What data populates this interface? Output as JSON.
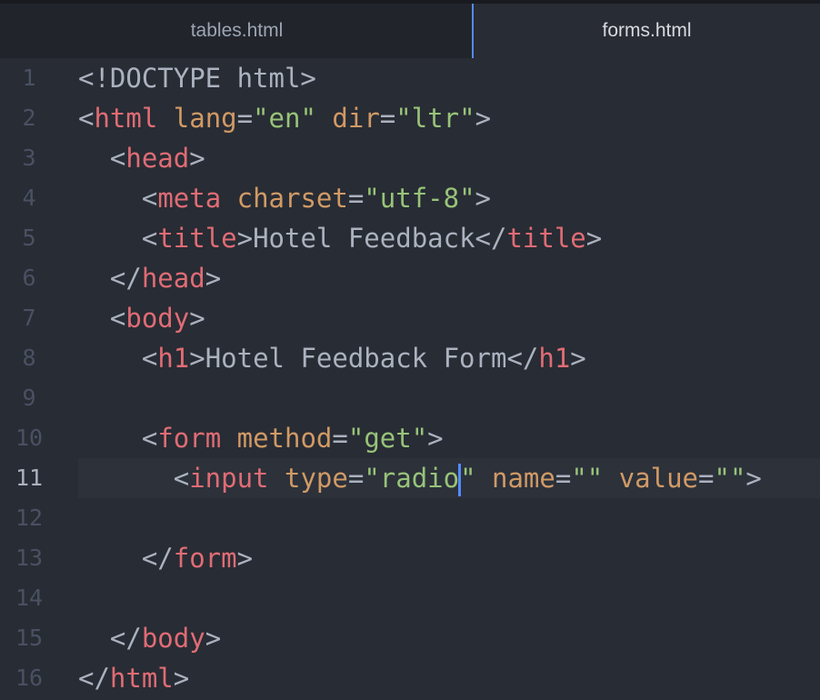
{
  "tabs": [
    {
      "label": "tables.html",
      "active": false
    },
    {
      "label": "forms.html",
      "active": true
    }
  ],
  "theme": {
    "background": "#282c34",
    "tab_bar": "#21252b",
    "tag_color": "#e06c75",
    "attr_color": "#d19a66",
    "string_color": "#98c379",
    "text_color": "#abb2bf",
    "cursor_color": "#528bff"
  },
  "editor": {
    "current_line": 11,
    "lines": [
      {
        "n": "1",
        "tokens": [
          {
            "t": "punc",
            "v": "<!DOCTYPE html>"
          }
        ]
      },
      {
        "n": "2",
        "tokens": [
          {
            "t": "punc",
            "v": "<"
          },
          {
            "t": "tag",
            "v": "html"
          },
          {
            "t": "punc",
            "v": " "
          },
          {
            "t": "attr",
            "v": "lang"
          },
          {
            "t": "punc",
            "v": "="
          },
          {
            "t": "str",
            "v": "\"en\""
          },
          {
            "t": "punc",
            "v": " "
          },
          {
            "t": "attr",
            "v": "dir"
          },
          {
            "t": "punc",
            "v": "="
          },
          {
            "t": "str",
            "v": "\"ltr\""
          },
          {
            "t": "punc",
            "v": ">"
          }
        ]
      },
      {
        "n": "3",
        "tokens": [
          {
            "t": "punc",
            "v": "  <"
          },
          {
            "t": "tag",
            "v": "head"
          },
          {
            "t": "punc",
            "v": ">"
          }
        ]
      },
      {
        "n": "4",
        "tokens": [
          {
            "t": "punc",
            "v": "    <"
          },
          {
            "t": "tag",
            "v": "meta"
          },
          {
            "t": "punc",
            "v": " "
          },
          {
            "t": "attr",
            "v": "charset"
          },
          {
            "t": "punc",
            "v": "="
          },
          {
            "t": "str",
            "v": "\"utf-8\""
          },
          {
            "t": "punc",
            "v": ">"
          }
        ]
      },
      {
        "n": "5",
        "tokens": [
          {
            "t": "punc",
            "v": "    <"
          },
          {
            "t": "tag",
            "v": "title"
          },
          {
            "t": "punc",
            "v": ">"
          },
          {
            "t": "text",
            "v": "Hotel Feedback"
          },
          {
            "t": "punc",
            "v": "</"
          },
          {
            "t": "tag",
            "v": "title"
          },
          {
            "t": "punc",
            "v": ">"
          }
        ]
      },
      {
        "n": "6",
        "tokens": [
          {
            "t": "punc",
            "v": "  </"
          },
          {
            "t": "tag",
            "v": "head"
          },
          {
            "t": "punc",
            "v": ">"
          }
        ]
      },
      {
        "n": "7",
        "tokens": [
          {
            "t": "punc",
            "v": "  <"
          },
          {
            "t": "tag",
            "v": "body"
          },
          {
            "t": "punc",
            "v": ">"
          }
        ]
      },
      {
        "n": "8",
        "tokens": [
          {
            "t": "punc",
            "v": "    <"
          },
          {
            "t": "tag",
            "v": "h1"
          },
          {
            "t": "punc",
            "v": ">"
          },
          {
            "t": "text",
            "v": "Hotel Feedback Form"
          },
          {
            "t": "punc",
            "v": "</"
          },
          {
            "t": "tag",
            "v": "h1"
          },
          {
            "t": "punc",
            "v": ">"
          }
        ]
      },
      {
        "n": "9",
        "tokens": []
      },
      {
        "n": "10",
        "tokens": [
          {
            "t": "punc",
            "v": "    <"
          },
          {
            "t": "tag",
            "v": "form"
          },
          {
            "t": "punc",
            "v": " "
          },
          {
            "t": "attr",
            "v": "method"
          },
          {
            "t": "punc",
            "v": "="
          },
          {
            "t": "str",
            "v": "\"get\""
          },
          {
            "t": "punc",
            "v": ">"
          }
        ]
      },
      {
        "n": "11",
        "tokens": [
          {
            "t": "punc",
            "v": "      <"
          },
          {
            "t": "tag",
            "v": "input"
          },
          {
            "t": "punc",
            "v": " "
          },
          {
            "t": "attr",
            "v": "type"
          },
          {
            "t": "punc",
            "v": "="
          },
          {
            "t": "str",
            "v": "\"radio"
          },
          {
            "t": "cursor",
            "v": ""
          },
          {
            "t": "str",
            "v": "\""
          },
          {
            "t": "punc",
            "v": " "
          },
          {
            "t": "attr",
            "v": "name"
          },
          {
            "t": "punc",
            "v": "="
          },
          {
            "t": "str",
            "v": "\"\""
          },
          {
            "t": "punc",
            "v": " "
          },
          {
            "t": "attr",
            "v": "value"
          },
          {
            "t": "punc",
            "v": "="
          },
          {
            "t": "str",
            "v": "\"\""
          },
          {
            "t": "punc",
            "v": ">"
          }
        ]
      },
      {
        "n": "12",
        "tokens": []
      },
      {
        "n": "13",
        "tokens": [
          {
            "t": "punc",
            "v": "    </"
          },
          {
            "t": "tag",
            "v": "form"
          },
          {
            "t": "punc",
            "v": ">"
          }
        ]
      },
      {
        "n": "14",
        "tokens": []
      },
      {
        "n": "15",
        "tokens": [
          {
            "t": "punc",
            "v": "  </"
          },
          {
            "t": "tag",
            "v": "body"
          },
          {
            "t": "punc",
            "v": ">"
          }
        ]
      },
      {
        "n": "16",
        "tokens": [
          {
            "t": "punc",
            "v": "</"
          },
          {
            "t": "tag",
            "v": "html"
          },
          {
            "t": "punc",
            "v": ">"
          }
        ]
      }
    ]
  }
}
